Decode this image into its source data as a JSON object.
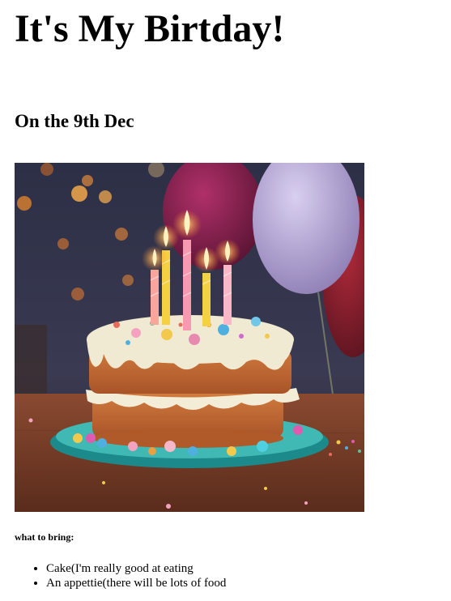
{
  "page": {
    "heading": "It's My Birtday!",
    "subheading": "On the 9th Dec",
    "image_icon": "birthday-cake-photo",
    "bring_label": "what to bring:",
    "items": [
      "Cake(I'm really good at eating",
      "An appettie(there will be lots of food"
    ]
  }
}
